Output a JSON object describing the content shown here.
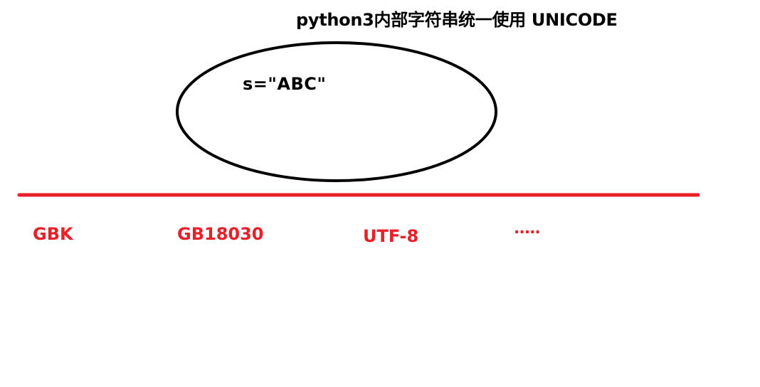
{
  "title": "python3内部字符串统一使用 UNICODE",
  "ellipse": {
    "label": "s=\"ABC\""
  },
  "encodings": [
    "GBK",
    "GB18030",
    "UTF-8",
    "....."
  ],
  "colors": {
    "text": "#000000",
    "accent": "#e8202a",
    "outline": "#000000"
  }
}
